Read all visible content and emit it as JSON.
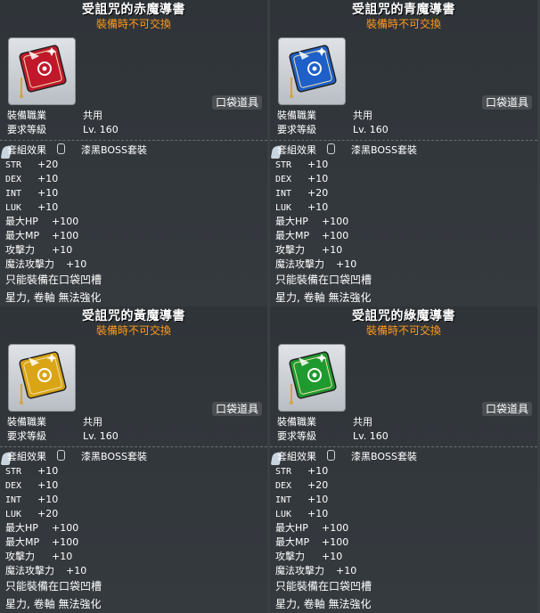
{
  "panels": [
    {
      "title": "受詛咒的赤魔導書",
      "subtitle": "裝備時不可交換",
      "color": "#c0182a",
      "item_icon": "red-grimoire-icon",
      "pocket_badge": "口袋道具",
      "job_label": "裝備職業",
      "job_value": "共用",
      "level_label": "要求等級",
      "level_value": "Lv. 160",
      "set_label": "套組效果",
      "set_value": "漆黑BOSS套裝",
      "stats": [
        {
          "name": "STR",
          "value": "+20"
        },
        {
          "name": "DEX",
          "value": "+10"
        },
        {
          "name": "INT",
          "value": "+10"
        },
        {
          "name": "LUK",
          "value": "+10"
        },
        {
          "name": "最大HP",
          "value": "+100"
        },
        {
          "name": "最大MP",
          "value": "+100"
        },
        {
          "name": "攻擊力",
          "value": "+10"
        },
        {
          "name": "魔法攻擊力",
          "value": "+10"
        }
      ],
      "note1": "只能裝備在口袋凹槽",
      "note2": "星力, 卷軸 無法強化"
    },
    {
      "title": "受詛咒的青魔導書",
      "subtitle": "裝備時不可交換",
      "color": "#1e5fc8",
      "item_icon": "blue-grimoire-icon",
      "pocket_badge": "口袋道具",
      "job_label": "裝備職業",
      "job_value": "共用",
      "level_label": "要求等級",
      "level_value": "Lv. 160",
      "set_label": "套組效果",
      "set_value": "漆黑BOSS套裝",
      "stats": [
        {
          "name": "STR",
          "value": "+10"
        },
        {
          "name": "DEX",
          "value": "+10"
        },
        {
          "name": "INT",
          "value": "+20"
        },
        {
          "name": "LUK",
          "value": "+10"
        },
        {
          "name": "最大HP",
          "value": "+100"
        },
        {
          "name": "最大MP",
          "value": "+100"
        },
        {
          "name": "攻擊力",
          "value": "+10"
        },
        {
          "name": "魔法攻擊力",
          "value": "+10"
        }
      ],
      "note1": "只能裝備在口袋凹槽",
      "note2": "星力, 卷軸 無法強化"
    },
    {
      "title": "受詛咒的黃魔導書",
      "subtitle": "裝備時不可交換",
      "color": "#d9a514",
      "item_icon": "yellow-grimoire-icon",
      "pocket_badge": "口袋道具",
      "job_label": "裝備職業",
      "job_value": "共用",
      "level_label": "要求等級",
      "level_value": "Lv. 160",
      "set_label": "套組效果",
      "set_value": "漆黑BOSS套裝",
      "stats": [
        {
          "name": "STR",
          "value": "+10"
        },
        {
          "name": "DEX",
          "value": "+10"
        },
        {
          "name": "INT",
          "value": "+10"
        },
        {
          "name": "LUK",
          "value": "+20"
        },
        {
          "name": "最大HP",
          "value": "+100"
        },
        {
          "name": "最大MP",
          "value": "+100"
        },
        {
          "name": "攻擊力",
          "value": "+10"
        },
        {
          "name": "魔法攻擊力",
          "value": "+10"
        }
      ],
      "note1": "只能裝備在口袋凹槽",
      "note2": "星力, 卷軸 無法強化"
    },
    {
      "title": "受詛咒的綠魔導書",
      "subtitle": "裝備時不可交換",
      "color": "#1e9a2e",
      "item_icon": "green-grimoire-icon",
      "pocket_badge": "口袋道具",
      "job_label": "裝備職業",
      "job_value": "共用",
      "level_label": "要求等級",
      "level_value": "Lv. 160",
      "set_label": "套組效果",
      "set_value": "漆黑BOSS套裝",
      "stats": [
        {
          "name": "STR",
          "value": "+10"
        },
        {
          "name": "DEX",
          "value": "+20"
        },
        {
          "name": "INT",
          "value": "+10"
        },
        {
          "name": "LUK",
          "value": "+10"
        },
        {
          "name": "最大HP",
          "value": "+100"
        },
        {
          "name": "最大MP",
          "value": "+100"
        },
        {
          "name": "攻擊力",
          "value": "+10"
        },
        {
          "name": "魔法攻擊力",
          "value": "+10"
        }
      ],
      "note1": "只能裝備在口袋凹槽",
      "note2": "星力, 卷軸 無法強化"
    }
  ]
}
